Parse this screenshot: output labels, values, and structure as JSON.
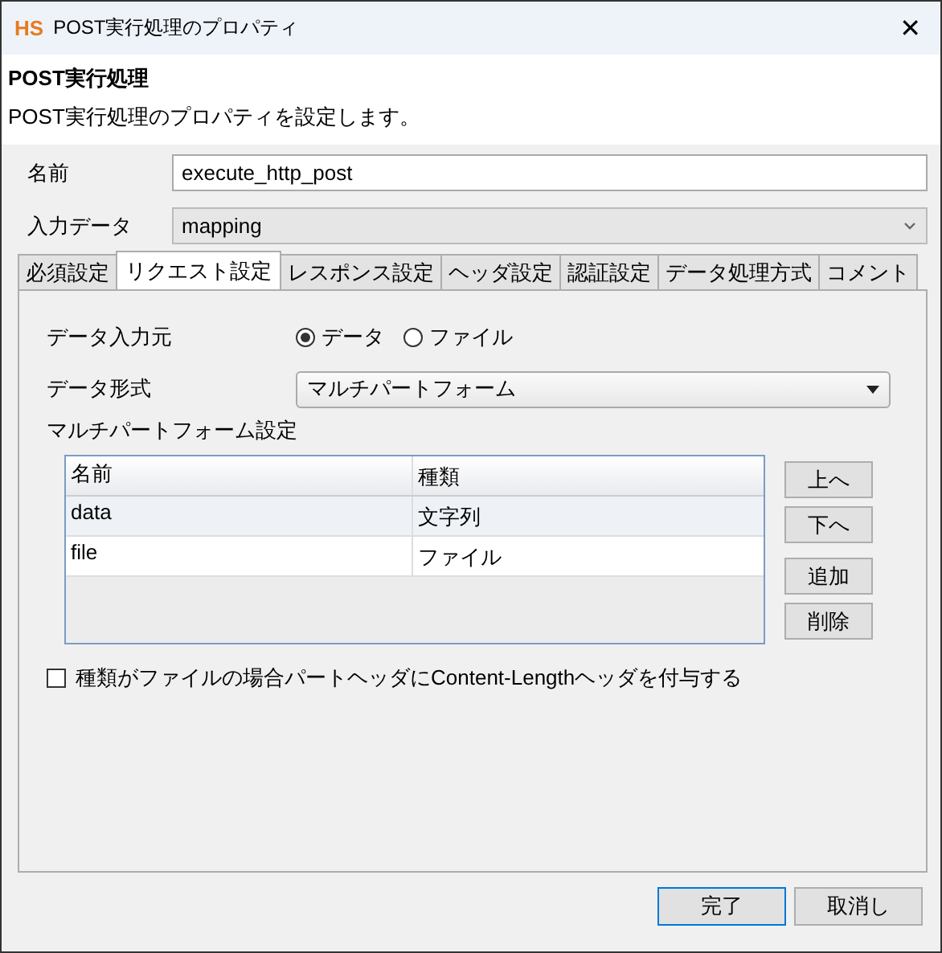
{
  "window": {
    "logo": "HS",
    "title": "POST実行処理のプロパティ",
    "close": "✕"
  },
  "header": {
    "title": "POST実行処理",
    "description": "POST実行処理のプロパティを設定します。"
  },
  "fields": [
    {
      "label": "名前",
      "kind": "text",
      "value": "execute_http_post",
      "disabled": false
    },
    {
      "label": "入力データ",
      "kind": "combo",
      "value": "mapping",
      "disabled": true
    }
  ],
  "tabs": [
    {
      "label": "必須設定",
      "selected": false
    },
    {
      "label": "リクエスト設定",
      "selected": true
    },
    {
      "label": "レスポンス設定",
      "selected": false
    },
    {
      "label": "ヘッダ設定",
      "selected": false
    },
    {
      "label": "認証設定",
      "selected": false
    },
    {
      "label": "データ処理方式",
      "selected": false
    },
    {
      "label": "コメント",
      "selected": false
    }
  ],
  "data_source": {
    "label": "データ入力元",
    "options": [
      {
        "label": "データ",
        "selected": true
      },
      {
        "label": "ファイル",
        "selected": false
      }
    ]
  },
  "data_format": {
    "label": "データ形式",
    "value": "マルチパートフォーム"
  },
  "multipart": {
    "label": "マルチパートフォーム設定",
    "columns": [
      "名前",
      "種類"
    ],
    "rows": [
      {
        "cells": [
          "data",
          "文字列"
        ],
        "selected": true
      },
      {
        "cells": [
          "file",
          "ファイル"
        ],
        "selected": false
      }
    ],
    "buttons": [
      "上へ",
      "下へ",
      "追加",
      "削除"
    ]
  },
  "content_length": {
    "label": "種類がファイルの場合パートヘッダにContent-Lengthヘッダを付与する",
    "checked": false
  },
  "footer_buttons": [
    {
      "label": "完了",
      "default": true
    },
    {
      "label": "取消し",
      "default": false
    }
  ]
}
